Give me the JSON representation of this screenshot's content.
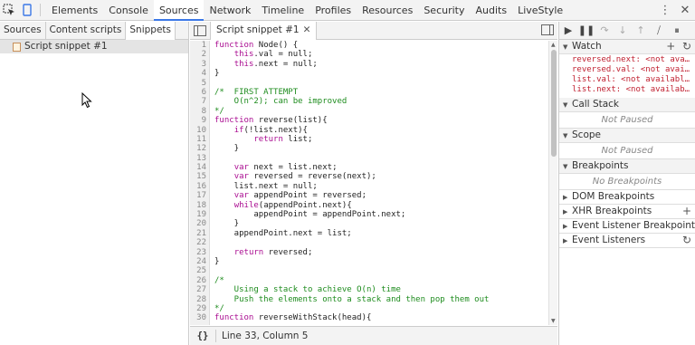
{
  "toolbar": {
    "inspect_icon": "inspect-element-icon",
    "device_icon": "device-mode-icon",
    "tabs": [
      "Elements",
      "Console",
      "Sources",
      "Network",
      "Timeline",
      "Profiles",
      "Resources",
      "Security",
      "Audits",
      "LiveStyle"
    ],
    "active_tab": "Sources",
    "menu_icon": "⋮",
    "close_icon": "✕"
  },
  "navigator": {
    "tabs": [
      "Sources",
      "Content scripts",
      "Snippets"
    ],
    "active_tab": "Snippets",
    "items": [
      "Script snippet #1"
    ]
  },
  "editor": {
    "file_tab": "Script snippet #1",
    "lines": [
      {
        "n": "1",
        "text": "function Node() {",
        "comment": false
      },
      {
        "n": "2",
        "text": "    this.val = null;",
        "comment": false
      },
      {
        "n": "3",
        "text": "    this.next = null;",
        "comment": false
      },
      {
        "n": "4",
        "text": "}",
        "comment": false
      },
      {
        "n": "5",
        "text": "",
        "comment": false
      },
      {
        "n": "6",
        "text": "/*  FIRST ATTEMPT",
        "comment": true
      },
      {
        "n": "7",
        "text": "    O(n^2); can be improved",
        "comment": true
      },
      {
        "n": "8",
        "text": "*/",
        "comment": true
      },
      {
        "n": "9",
        "text": "function reverse(list){",
        "comment": false
      },
      {
        "n": "10",
        "text": "    if(!list.next){",
        "comment": false
      },
      {
        "n": "11",
        "text": "        return list;",
        "comment": false
      },
      {
        "n": "12",
        "text": "    }",
        "comment": false
      },
      {
        "n": "13",
        "text": "",
        "comment": false
      },
      {
        "n": "14",
        "text": "    var next = list.next;",
        "comment": false
      },
      {
        "n": "15",
        "text": "    var reversed = reverse(next);",
        "comment": false
      },
      {
        "n": "16",
        "text": "    list.next = null;",
        "comment": false
      },
      {
        "n": "17",
        "text": "    var appendPoint = reversed;",
        "comment": false
      },
      {
        "n": "18",
        "text": "    while(appendPoint.next){",
        "comment": false
      },
      {
        "n": "19",
        "text": "        appendPoint = appendPoint.next;",
        "comment": false
      },
      {
        "n": "20",
        "text": "    }",
        "comment": false
      },
      {
        "n": "21",
        "text": "    appendPoint.next = list;",
        "comment": false
      },
      {
        "n": "22",
        "text": "",
        "comment": false
      },
      {
        "n": "23",
        "text": "    return reversed;",
        "comment": false
      },
      {
        "n": "24",
        "text": "}",
        "comment": false
      },
      {
        "n": "25",
        "text": "",
        "comment": false
      },
      {
        "n": "26",
        "text": "/*",
        "comment": true
      },
      {
        "n": "27",
        "text": "    Using a stack to achieve O(n) time",
        "comment": true
      },
      {
        "n": "28",
        "text": "    Push the elements onto a stack and then pop them out",
        "comment": true
      },
      {
        "n": "29",
        "text": "*/",
        "comment": true
      },
      {
        "n": "30",
        "text": "function reverseWithStack(head){",
        "comment": false
      }
    ],
    "status": "Line 33, Column 5",
    "format_button": "{}"
  },
  "sidebar": {
    "controls": [
      "❚❚",
      "⏸",
      "↷",
      "↓",
      "↑",
      "⧸",
      "⏸"
    ],
    "watch_title": "Watch",
    "watch_items": [
      "reversed.next: <not ava…",
      "reversed.val: <not avai…",
      "list.val: <not availabl…",
      "list.next: <not availab…"
    ],
    "call_stack_title": "Call Stack",
    "call_stack_msg": "Not Paused",
    "scope_title": "Scope",
    "scope_msg": "Not Paused",
    "breakpoints_title": "Breakpoints",
    "breakpoints_msg": "No Breakpoints",
    "dom_breakpoints": "DOM Breakpoints",
    "xhr_breakpoints": "XHR Breakpoints",
    "event_listener_breakpoints": "Event Listener Breakpoints",
    "event_listeners": "Event Listeners"
  }
}
